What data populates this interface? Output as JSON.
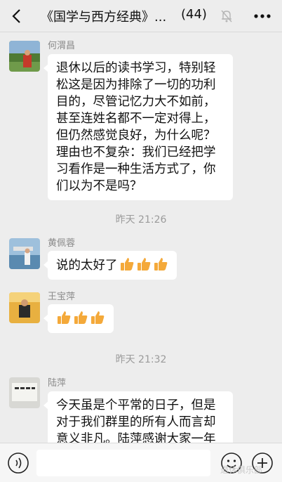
{
  "header": {
    "title": "《国学与西方经典》...",
    "member_count": "(44)",
    "back_icon": "chevron-left-icon",
    "mute_icon": "bell-off-icon",
    "more_icon": "more-dots-icon"
  },
  "messages": [
    {
      "sender": "何渭昌",
      "lines": [
        "退休以后的读书学习，特别轻",
        "松这是因为排除了一切的功利",
        "目的，尽管记忆力大不如前，",
        "甚至连姓名都不一定对得上，",
        "但仍然感觉良好，为什么呢？",
        "理由也不复杂：我们已经把学",
        "习看作是一种生活方式了，你",
        "们以为不是吗？"
      ]
    },
    {
      "timestamp": "昨天 21:26"
    },
    {
      "sender": "黄佩蓉",
      "text": "说的太好了",
      "emoji": "thumbs-up-icon",
      "emoji_count": 3
    },
    {
      "sender": "王宝萍",
      "text": "",
      "emoji": "thumbs-up-icon",
      "emoji_count": 3
    },
    {
      "timestamp": "昨天 21:32"
    },
    {
      "sender": "陆萍",
      "lines": [
        "今天虽是个平常的日子，但是",
        "对于我们群里的所有人而言却",
        "意义非凡。陆萍感谢大家一年"
      ]
    }
  ],
  "footer": {
    "voice_icon": "voice-icon",
    "emoji_icon": "emoji-face-icon",
    "plus_icon": "plus-circle-icon",
    "input_value": ""
  },
  "watermark": "退休俱乐部",
  "colors": {
    "chat_bg": "#ededed",
    "bubble_bg": "#ffffff",
    "thumbs": "#f4a93a"
  }
}
